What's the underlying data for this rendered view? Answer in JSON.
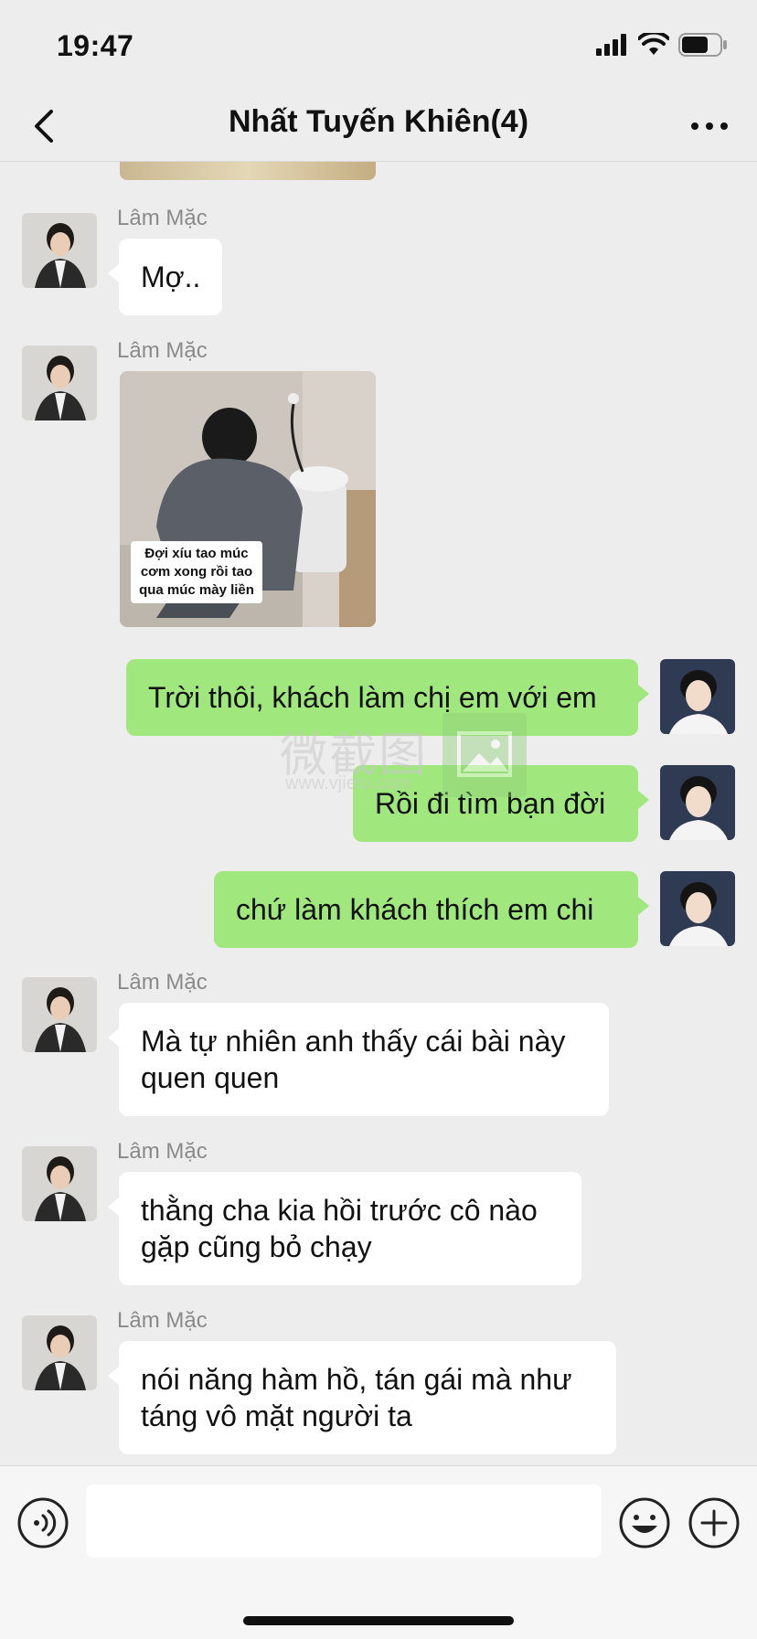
{
  "status_bar": {
    "time": "19:47"
  },
  "nav": {
    "title": "Nhất Tuyến Khiên(4)"
  },
  "watermark": {
    "text": "微截图",
    "url": "www.vjietu.com"
  },
  "messages": [
    {
      "side": "in",
      "sender": "Lâm Mặc",
      "text": "Mợ.."
    },
    {
      "side": "in",
      "sender": "Lâm Mặc",
      "image_caption": "Đợi xíu tao múc cơm xong rồi tao qua múc mày liền"
    },
    {
      "side": "out",
      "text": "Trời thôi, khách làm chị em với em"
    },
    {
      "side": "out",
      "text": "Rồi đi tìm bạn đời"
    },
    {
      "side": "out",
      "text": "chứ làm khách thích em chi"
    },
    {
      "side": "in",
      "sender": "Lâm Mặc",
      "text": "Mà tự nhiên anh thấy cái bài này quen quen"
    },
    {
      "side": "in",
      "sender": "Lâm Mặc",
      "text": "thằng cha kia hồi trước cô nào gặp cũng bỏ chạy"
    },
    {
      "side": "in",
      "sender": "Lâm Mặc",
      "text": "nói năng hàm hồ, tán gái mà như táng vô mặt người ta"
    }
  ],
  "input": {
    "value": ""
  },
  "colors": {
    "outgoing_bubble": "#a0e77e",
    "incoming_bubble": "#ffffff",
    "background": "#ededed"
  }
}
